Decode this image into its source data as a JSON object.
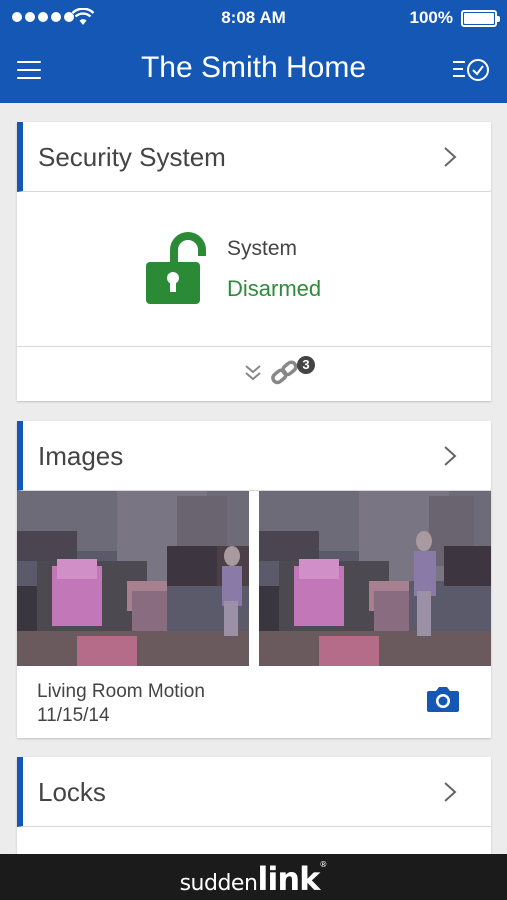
{
  "status_bar": {
    "time": "8:08 AM",
    "battery": "100%"
  },
  "header": {
    "title": "The Smith Home"
  },
  "security_card": {
    "title": "Security System",
    "system_label": "System",
    "system_status": "Disarmed",
    "link_badge": "3",
    "status_color": "#2e8b3a"
  },
  "images_card": {
    "title": "Images",
    "caption": "Living Room Motion",
    "date": "11/15/14"
  },
  "locks_card": {
    "title": "Locks"
  },
  "footer": {
    "brand_part1": "sudden",
    "brand_part2": "link",
    "brand_mark": "®"
  },
  "colors": {
    "accent": "#1457b4",
    "footer_bg": "#1b1b1b"
  },
  "icons": [
    "menu-icon",
    "schedule-check-icon",
    "chevron-right-icon",
    "unlocked-padlock-icon",
    "double-chevron-down-icon",
    "link-icon",
    "camera-icon"
  ]
}
